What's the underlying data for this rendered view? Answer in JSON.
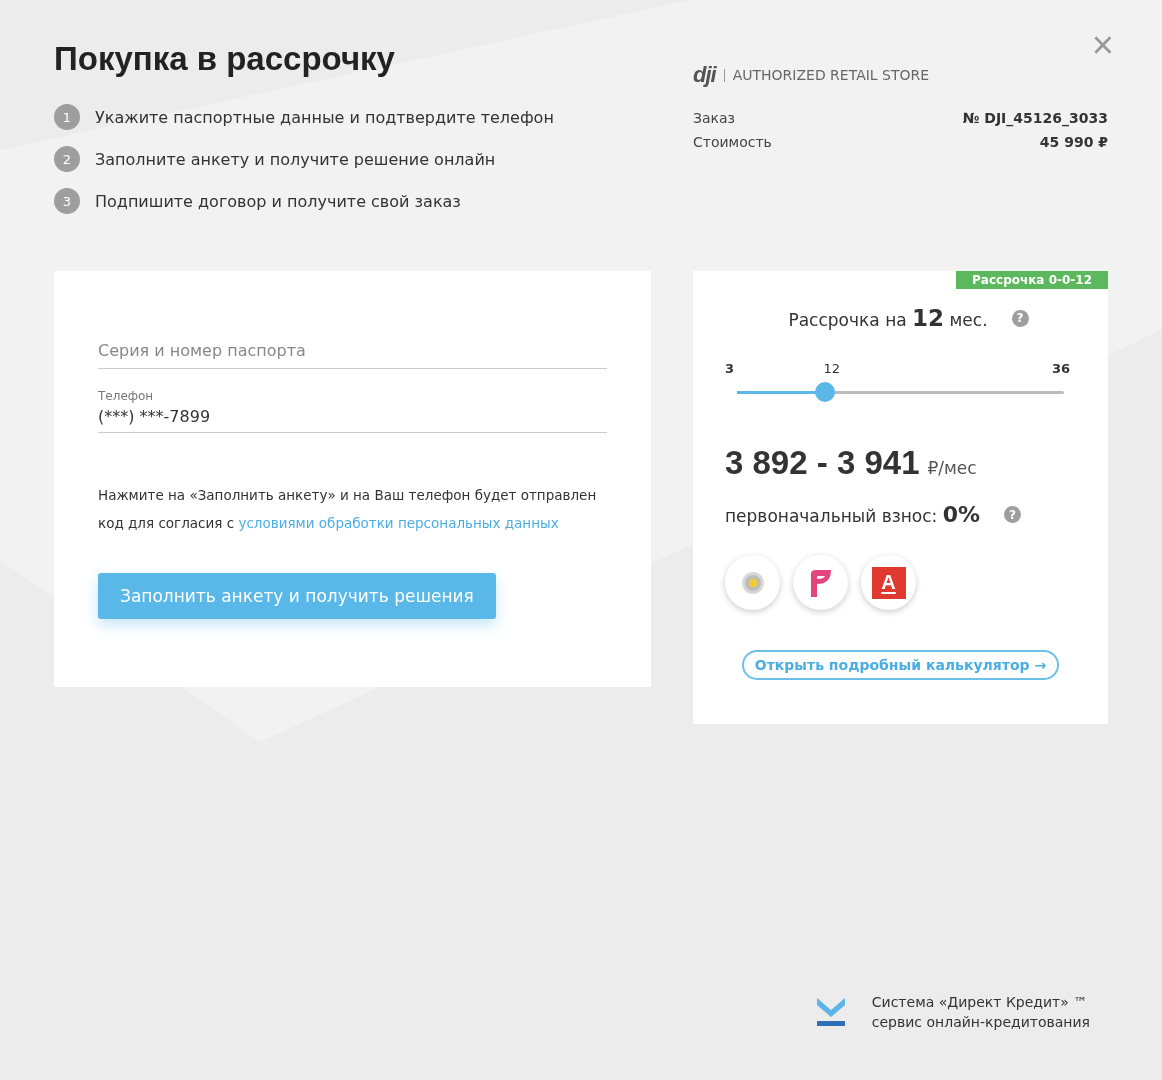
{
  "title": "Покупка в рассрочку",
  "steps": [
    {
      "number": "1",
      "text": "Укажите паспортные данные и подтвердите телефон"
    },
    {
      "number": "2",
      "text": "Заполните анкету и получите решение онлайн"
    },
    {
      "number": "3",
      "text": "Подпишите договор и получите свой заказ"
    }
  ],
  "close": "×",
  "store": {
    "logo": "dji",
    "name": "AUTHORIZED RETAIL STORE"
  },
  "order": [
    {
      "label": "Заказ",
      "value": "№ DJI_45126_3033"
    },
    {
      "label": "Стоимость",
      "value": "45 990 ₽"
    }
  ],
  "form": {
    "passport": {
      "placeholder": "Серия и номер паспорта"
    },
    "phone": {
      "label": "Телефон",
      "value": "(***) ***-7899"
    },
    "consent": {
      "text": "Нажмите на «Заполнить анкету» и на Ваш телефон будет отправлен код для согласия с",
      "link": "условиями обработки персональных данных"
    },
    "submit": "Заполнить анкету и получить решения"
  },
  "calculator": {
    "badge": "Рассрочка 0-0-12",
    "term": {
      "prefix": "Рассрочка на",
      "months": "12",
      "suffix": "мес."
    },
    "help": "?",
    "slider": {
      "min": "3",
      "value": "12",
      "max": "36",
      "level": 0.27
    },
    "payment": {
      "amount": "3 892 - 3 941",
      "unit": "₽/мес"
    },
    "down_payment": {
      "label": "первоначальный взнос:",
      "value": "0%"
    },
    "banks": [
      {
        "kind": "emblem"
      },
      {
        "kind": "ribbon"
      },
      {
        "kind": "letter",
        "letter": "А"
      }
    ],
    "link": "Открыть подробный калькулятор →"
  },
  "footer": {
    "line_1": "Система «Директ Кредит» ™",
    "line_2": "сервис онлайн-кредитования"
  }
}
